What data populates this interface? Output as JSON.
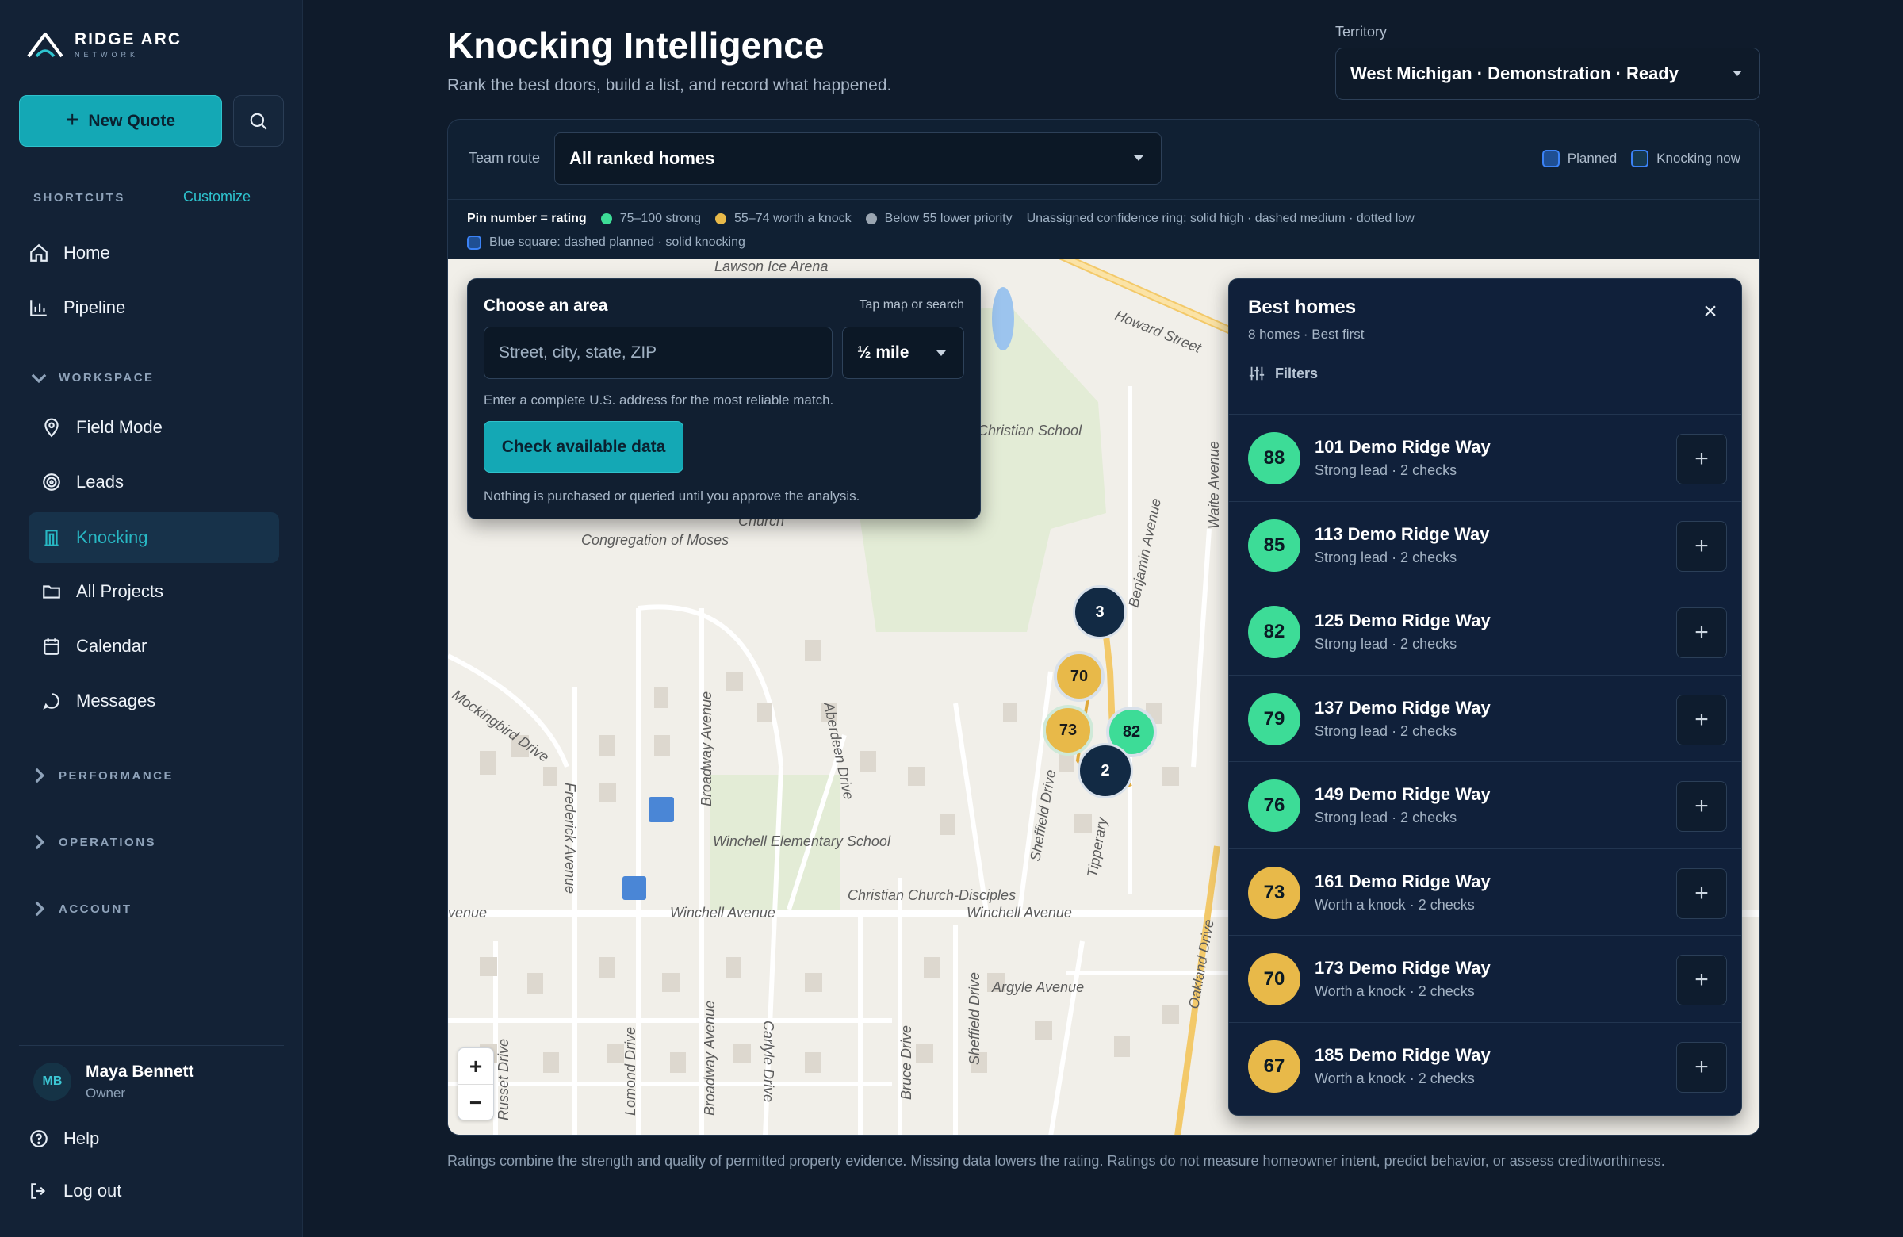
{
  "brand": {
    "name": "RIDGE ARC",
    "tagline": "NETWORK"
  },
  "sidebar": {
    "new_quote_label": "New Quote",
    "shortcuts_label": "SHORTCUTS",
    "customize_label": "Customize",
    "shortcuts": [
      {
        "label": "Home",
        "icon": "home-icon"
      },
      {
        "label": "Pipeline",
        "icon": "bar-chart-icon"
      }
    ],
    "workspace_label": "WORKSPACE",
    "workspace": [
      {
        "label": "Field Mode",
        "icon": "map-pin-icon"
      },
      {
        "label": "Leads",
        "icon": "target-icon"
      },
      {
        "label": "Knocking",
        "icon": "door-icon",
        "active": true
      },
      {
        "label": "All Projects",
        "icon": "folder-icon"
      },
      {
        "label": "Calendar",
        "icon": "calendar-icon"
      },
      {
        "label": "Messages",
        "icon": "message-icon"
      }
    ],
    "sections": [
      "PERFORMANCE",
      "OPERATIONS",
      "ACCOUNT"
    ],
    "user": {
      "initials": "MB",
      "name": "Maya Bennett",
      "role": "Owner"
    },
    "help_label": "Help",
    "logout_label": "Log out"
  },
  "header": {
    "title": "Knocking Intelligence",
    "subtitle": "Rank the best doors, build a list, and record what happened.",
    "territory_label": "Territory",
    "territory_value": "West Michigan · Demonstration · Ready"
  },
  "toolbar": {
    "route_label": "Team route",
    "route_value": "All ranked homes",
    "legend_planned": "Planned",
    "legend_knocking": "Knocking now"
  },
  "legend": {
    "pin_rating": "Pin number = rating",
    "strong": "75–100 strong",
    "worth": "55–74 worth a knock",
    "below": "Below 55 lower priority",
    "ring": "Unassigned confidence ring: solid high · dashed medium · dotted low",
    "square": "Blue square: dashed planned · solid knocking"
  },
  "area_panel": {
    "title": "Choose an area",
    "hint": "Tap map or search",
    "placeholder": "Street, city, state, ZIP",
    "radius": "½ mile",
    "help": "Enter a complete U.S. address for the most reliable match.",
    "button": "Check available data",
    "note": "Nothing is purchased or queried until you approve the analysis."
  },
  "map": {
    "labels": [
      "Lawson Ice Arena",
      "Howard Street",
      "Christian School",
      "Congregation of Moses",
      "Church",
      "Benjamin Avenue",
      "Waite Avenue",
      "Mockingbird Drive",
      "Broadway Avenue",
      "Aberdeen Drive",
      "Frederick Avenue",
      "Winchell Elementary School",
      "Christian Church-Disciples",
      "Sheffield Drive",
      "Tipperary",
      "Winchell Avenue",
      "Winchell Avenue",
      "Argyle Avenue",
      "Oakland Drive",
      "Russet Drive",
      "Lomond Drive",
      "Carlyle Drive",
      "Bruce Drive",
      "Sheffield Drive",
      "Broadway Avenue",
      "venue"
    ],
    "pins": [
      {
        "label": "3",
        "kind": "cluster"
      },
      {
        "label": "70",
        "kind": "worth"
      },
      {
        "label": "73",
        "kind": "worth"
      },
      {
        "label": "82",
        "kind": "strong"
      },
      {
        "label": "2",
        "kind": "cluster"
      }
    ],
    "zoom_in": "+",
    "zoom_out": "−"
  },
  "homes": {
    "title": "Best homes",
    "subtitle": "8 homes · Best first",
    "filters_label": "Filters",
    "close": "×",
    "items": [
      {
        "score": "88",
        "address": "101 Demo Ridge Way",
        "meta": "Strong lead · 2 checks",
        "tier": "strong"
      },
      {
        "score": "85",
        "address": "113 Demo Ridge Way",
        "meta": "Strong lead · 2 checks",
        "tier": "strong"
      },
      {
        "score": "82",
        "address": "125 Demo Ridge Way",
        "meta": "Strong lead · 2 checks",
        "tier": "strong"
      },
      {
        "score": "79",
        "address": "137 Demo Ridge Way",
        "meta": "Strong lead · 2 checks",
        "tier": "strong"
      },
      {
        "score": "76",
        "address": "149 Demo Ridge Way",
        "meta": "Strong lead · 2 checks",
        "tier": "strong"
      },
      {
        "score": "73",
        "address": "161 Demo Ridge Way",
        "meta": "Worth a knock · 2 checks",
        "tier": "worth"
      },
      {
        "score": "70",
        "address": "173 Demo Ridge Way",
        "meta": "Worth a knock · 2 checks",
        "tier": "worth"
      },
      {
        "score": "67",
        "address": "185 Demo Ridge Way",
        "meta": "Worth a knock · 2 checks",
        "tier": "worth"
      }
    ],
    "add_label": "+"
  },
  "footer": "Ratings combine the strength and quality of permitted property evidence. Missing data lowers the rating. Ratings do not measure homeowner intent, predict behavior, or assess creditworthiness.",
  "colors": {
    "accent": "#14a8b5",
    "strong": "#3ddc97",
    "worth": "#e8b949",
    "low": "#9aa5b1",
    "cluster": "#122a44",
    "planned": "#3b82f6"
  }
}
